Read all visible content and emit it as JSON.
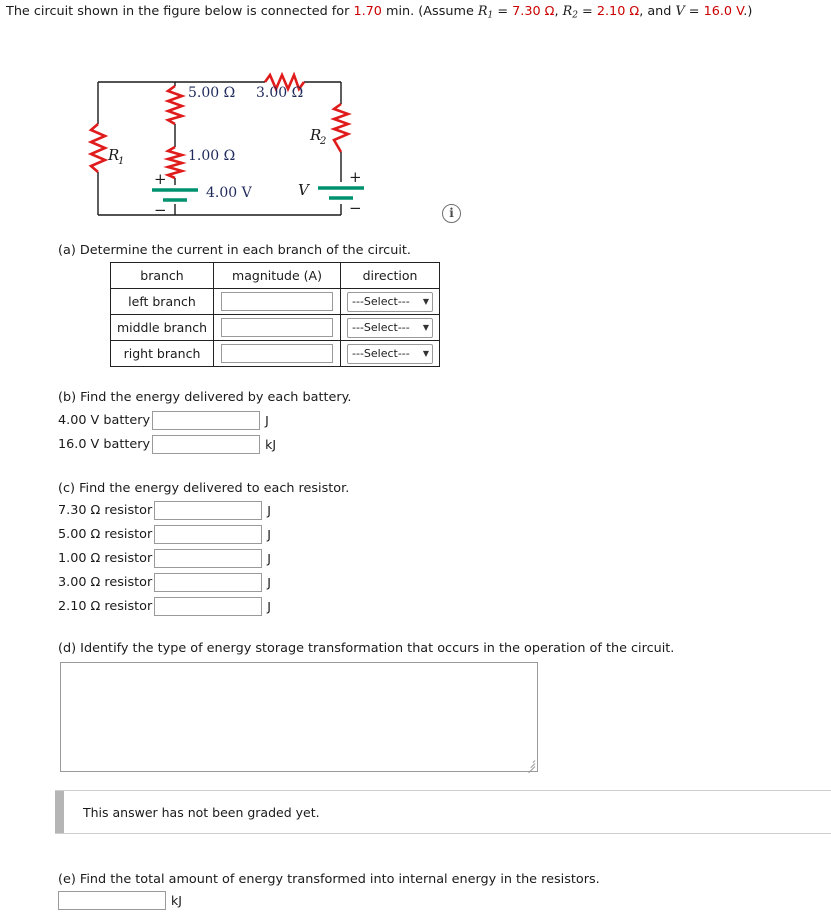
{
  "intro": {
    "text_before": "The circuit shown in the figure below is connected for ",
    "time_value": "1.70",
    "text_mid": " min. (Assume ",
    "r1_name": "R",
    "r1_sub": "1",
    "r1_eq": " = ",
    "r1_value": "7.30 Ω",
    "sep1": ", ",
    "r2_name": "R",
    "r2_sub": "2",
    "r2_eq": " = ",
    "r2_value": "2.10 Ω",
    "sep2": ", and ",
    "v_name": "V",
    "v_eq": " = ",
    "v_value": "16.0 V",
    "text_end": ".)"
  },
  "circuit": {
    "labels": {
      "r_left": "R",
      "r_left_sub": "1",
      "r_top_middle": "5.00 Ω",
      "r_top_right": "3.00 Ω",
      "r_middle": "1.00 Ω",
      "r_right": "R",
      "r_right_sub": "2",
      "battery_left": "4.00 V",
      "battery_right": "V",
      "plus_left": "+",
      "minus_left": "−",
      "plus_right": "+",
      "minus_right": "−"
    },
    "colors": {
      "resistor": "#e01b1b",
      "battery": "#00916e",
      "wire": "#1a1a1a",
      "label": "#1f2a5b"
    },
    "info_icon": "i"
  },
  "parts": {
    "a": {
      "question": "(a) Determine the current in each branch of the circuit.",
      "columns": [
        "branch",
        "magnitude (A)",
        "direction"
      ],
      "rows": [
        {
          "branch": "left branch",
          "magnitude": "",
          "direction": "---Select---"
        },
        {
          "branch": "middle branch",
          "magnitude": "",
          "direction": "---Select---"
        },
        {
          "branch": "right branch",
          "magnitude": "",
          "direction": "---Select---"
        }
      ],
      "caret": "▼"
    },
    "b": {
      "question": "(b) Find the energy delivered by each battery.",
      "rows": [
        {
          "label": "4.00 V battery",
          "value": "",
          "unit": "J"
        },
        {
          "label": "16.0 V battery",
          "value": "",
          "unit": "kJ"
        }
      ]
    },
    "c": {
      "question": "(c) Find the energy delivered to each resistor.",
      "rows": [
        {
          "label": "7.30 Ω resistor",
          "value": "",
          "unit": "J"
        },
        {
          "label": "5.00 Ω resistor",
          "value": "",
          "unit": "J"
        },
        {
          "label": "1.00 Ω resistor",
          "value": "",
          "unit": "J"
        },
        {
          "label": "3.00 Ω resistor",
          "value": "",
          "unit": "J"
        },
        {
          "label": "2.10 Ω resistor",
          "value": "",
          "unit": "J"
        }
      ]
    },
    "d": {
      "question": "(d) Identify the type of energy storage transformation that occurs in the operation of the circuit.",
      "answer": "",
      "grade_message": "This answer has not been graded yet."
    },
    "e": {
      "question": "(e) Find the total amount of energy transformed into internal energy in the resistors.",
      "value": "",
      "unit": "kJ"
    }
  }
}
